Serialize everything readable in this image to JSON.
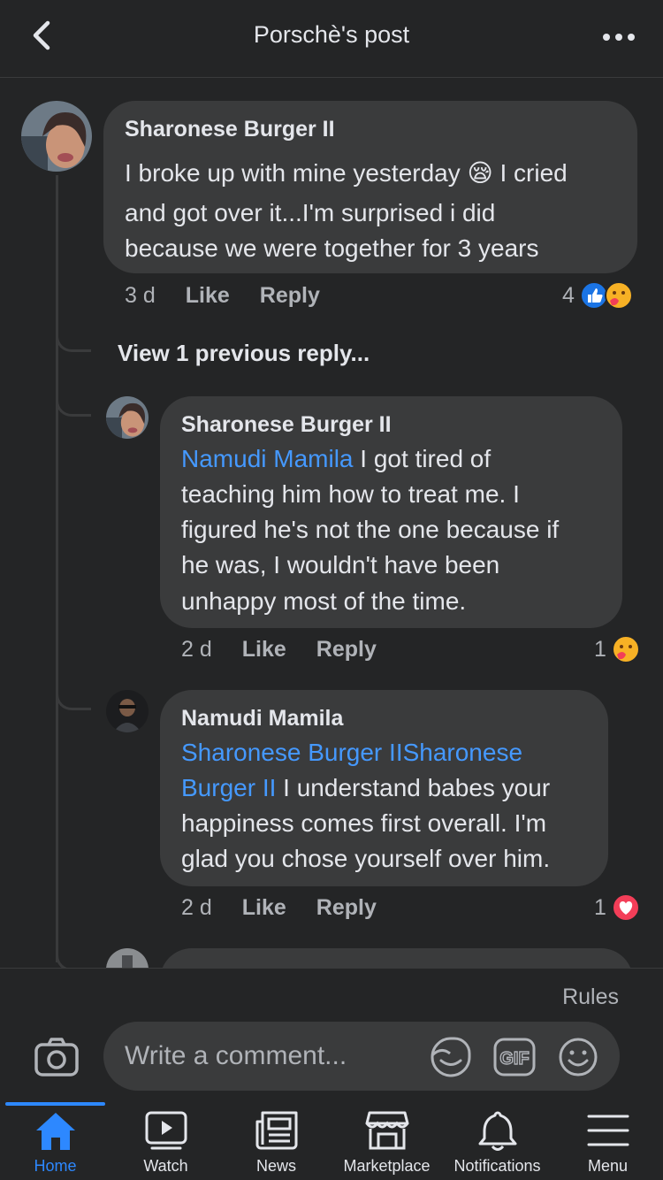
{
  "header": {
    "title": "Porschè's post"
  },
  "thread": {
    "comment": {
      "author": "Sharonese Burger II",
      "text_line1": "I broke up with mine yesterday 😪 I cried",
      "text_line2": "and got over it...I'm surprised i did",
      "text_line3": "because we were together for 3 years",
      "time": "3 d",
      "like_label": "Like",
      "reply_label": "Reply",
      "reaction_count": "4",
      "reactions": [
        "like",
        "care"
      ]
    },
    "view_previous": "View 1 previous reply...",
    "replies": [
      {
        "author": "Sharonese Burger II",
        "mention": "Namudi Mamila",
        "line1_rest": " I got tired of",
        "line2": "teaching him how to treat me. I",
        "line3": "figured he's not the one because if",
        "line4": "he was, I wouldn't have been",
        "line5": "unhappy most of the time.",
        "time": "2 d",
        "like_label": "Like",
        "reply_label": "Reply",
        "reaction_count": "1",
        "reactions": [
          "care"
        ]
      },
      {
        "author": "Namudi Mamila",
        "mention_line1": "Sharonese Burger IISharonese",
        "mention_line2": "Burger II",
        "line2_rest": " I understand babes your",
        "line3": "happiness comes first overall. I'm",
        "line4": "glad you chose yourself over him.",
        "time": "2 d",
        "like_label": "Like",
        "reply_label": "Reply",
        "reaction_count": "1",
        "reactions": [
          "love"
        ]
      }
    ]
  },
  "composer": {
    "rules_label": "Rules",
    "placeholder": "Write a comment...",
    "icons": [
      "camera-icon",
      "sticker-icon",
      "gif-icon",
      "emoji-icon"
    ]
  },
  "nav": {
    "items": [
      {
        "label": "Home",
        "icon": "home-icon",
        "active": true
      },
      {
        "label": "Watch",
        "icon": "watch-icon",
        "active": false
      },
      {
        "label": "News",
        "icon": "news-icon",
        "active": false
      },
      {
        "label": "Marketplace",
        "icon": "marketplace-icon",
        "active": false
      },
      {
        "label": "Notifications",
        "icon": "bell-icon",
        "active": false
      },
      {
        "label": "Menu",
        "icon": "menu-icon",
        "active": false
      }
    ]
  },
  "colors": {
    "background": "#242526",
    "bubble": "#3a3b3c",
    "accent": "#2d88ff",
    "mention": "#4599ff",
    "love": "#f33e58"
  }
}
